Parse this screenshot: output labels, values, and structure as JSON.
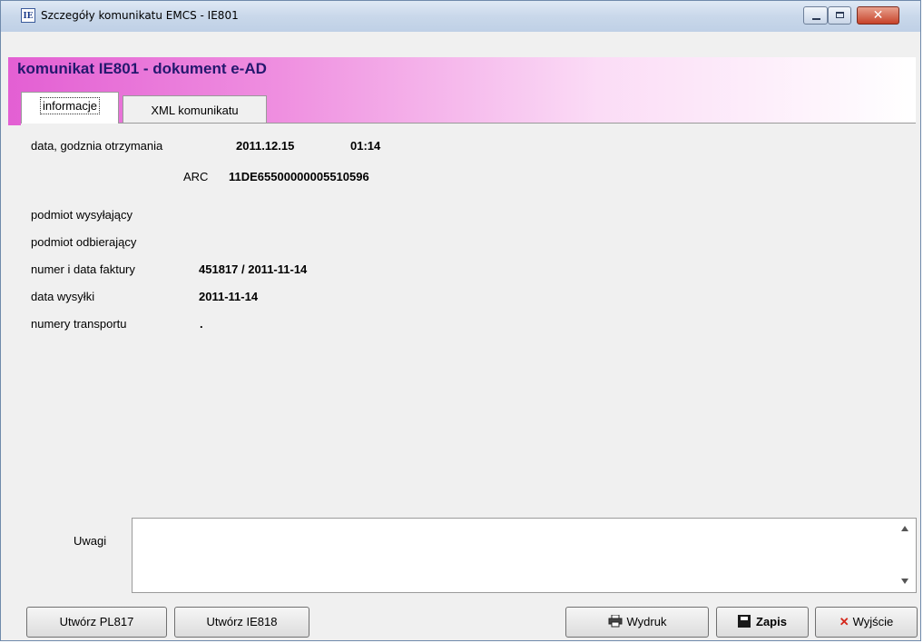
{
  "window": {
    "icon_text": "IE",
    "title": "Szczegóły komunikatu EMCS - IE801",
    "close_glyph": "✕"
  },
  "header": {
    "title": "komunikat IE801 - dokument e-AD"
  },
  "tabs": [
    {
      "label": "informacje",
      "active": true
    },
    {
      "label": "XML komunikatu",
      "active": false
    }
  ],
  "info": {
    "received_label": "data, godznia otrzymania",
    "received_date": "2011.12.15",
    "received_time": "01:14",
    "arc_label": "ARC",
    "arc_value": "11DE65500000005510596",
    "sender_label": "podmiot wysyłający",
    "receiver_label": "podmiot odbierający",
    "invoice_label": "numer i data faktury",
    "invoice_value": "451817 / 2011-11-14",
    "ship_date_label": "data wysyłki",
    "ship_date_value": "2011-11-14",
    "transport_label": "numery transportu",
    "transport_value": "."
  },
  "notes": {
    "label": "Uwagi",
    "value": ""
  },
  "buttons": {
    "create_pl817": "Utwórz PL817",
    "create_ie818": "Utwórz IE818",
    "print": "Wydruk",
    "save": "Zapis",
    "exit": "Wyjście"
  },
  "icons": {
    "print": "printer-icon",
    "save": "floppy-icon",
    "exit": "red-x-icon"
  },
  "colors": {
    "header_title": "#24186e",
    "banner_start": "#e35fd3",
    "exit_x": "#d4261a"
  }
}
